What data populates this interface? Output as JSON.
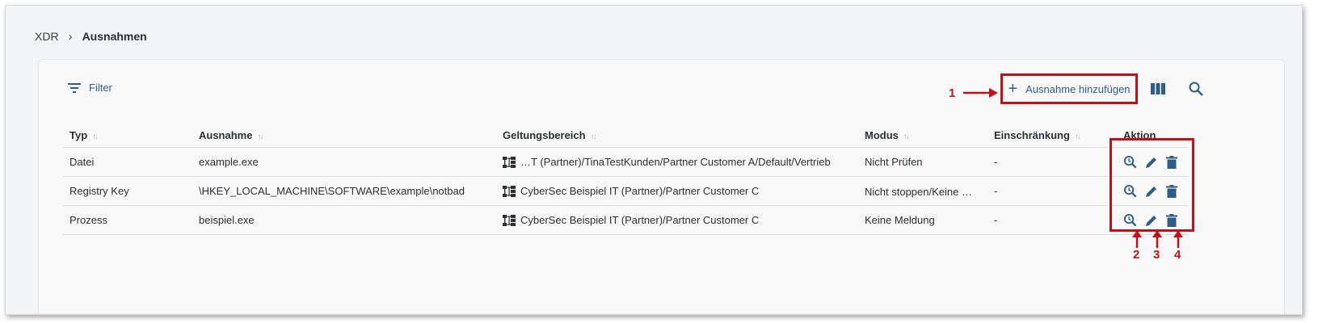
{
  "breadcrumb": {
    "root": "XDR",
    "separator": "›",
    "current": "Ausnahmen"
  },
  "toolbar": {
    "filter_label": "Filter",
    "add_label": "Ausnahme hinzufügen",
    "add_icon": "+",
    "columns_icon": "columns-icon",
    "search_icon": "search-icon"
  },
  "table": {
    "headers": [
      "Typ",
      "Ausnahme",
      "Geltungsbereich",
      "Modus",
      "Einschränkung",
      "Aktion"
    ],
    "sort_glyph": "↑↓",
    "rows": [
      {
        "typ": "Datei",
        "ausnahme": "example.exe",
        "scope": "…T (Partner)/TinaTestKunden/Partner Customer A/Default/Vertrieb",
        "modus": "Nicht Prüfen",
        "einschraenkung": "-"
      },
      {
        "typ": "Registry Key",
        "ausnahme": "\\HKEY_LOCAL_MACHINE\\SOFTWARE\\example\\notbad",
        "scope": "CyberSec Beispiel IT (Partner)/Partner Customer C",
        "modus": "Nicht stoppen/Keine Meldung",
        "einschraenkung": "-"
      },
      {
        "typ": "Prozess",
        "ausnahme": "beispiel.exe",
        "scope": "CyberSec Beispiel IT (Partner)/Partner Customer C",
        "modus": "Keine Meldung",
        "einschraenkung": "-"
      }
    ]
  },
  "annotations": {
    "n1": "1",
    "n2": "2",
    "n3": "3",
    "n4": "4"
  },
  "colors": {
    "accent": "#2f5d86",
    "annotation": "#c0111b"
  }
}
